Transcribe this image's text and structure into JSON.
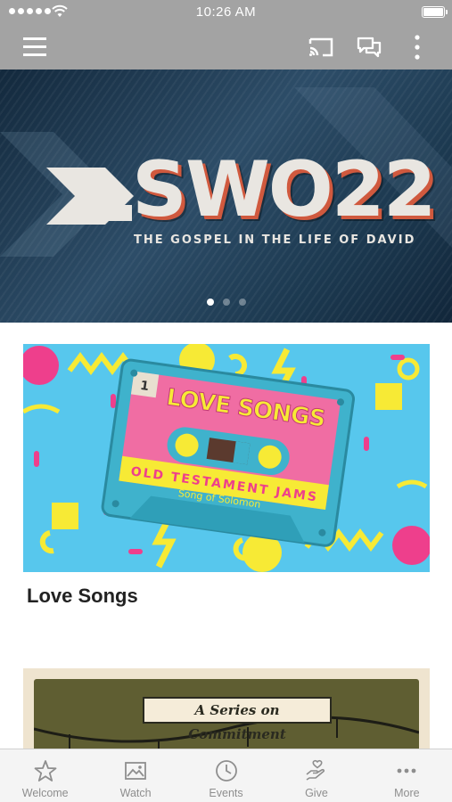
{
  "status_bar": {
    "time": "10:26 AM"
  },
  "app_bar": {
    "icons": [
      "menu-icon",
      "cast-icon",
      "chat-icon",
      "more-vertical-icon"
    ]
  },
  "hero": {
    "logo_text": "SWO22",
    "subtitle": "THE GOSPEL IN THE LIFE OF DAVID",
    "carousel_pages": 3,
    "active_page": 1
  },
  "cards": [
    {
      "title": "Love Songs",
      "art": {
        "tape_number": "1",
        "tape_title": "LOVE SONGS",
        "tape_subtitle": "OLD TESTAMENT JAMS",
        "tape_caption": "Song of Solomon"
      }
    },
    {
      "title": "",
      "art": {
        "banner": "A Series on Commitment"
      }
    }
  ],
  "tabs": [
    {
      "label": "Welcome",
      "icon": "star-icon"
    },
    {
      "label": "Watch",
      "icon": "image-icon"
    },
    {
      "label": "Events",
      "icon": "clock-icon"
    },
    {
      "label": "Give",
      "icon": "hand-heart-icon"
    },
    {
      "label": "More",
      "icon": "more-horizontal-icon"
    }
  ],
  "colors": {
    "app_bar": "#a3a3a3",
    "tab_inactive": "#8e8e8e",
    "love_songs_bg": "#57c7ed",
    "cassette_pink": "#f06da3",
    "accent_yellow": "#f7ea35"
  }
}
